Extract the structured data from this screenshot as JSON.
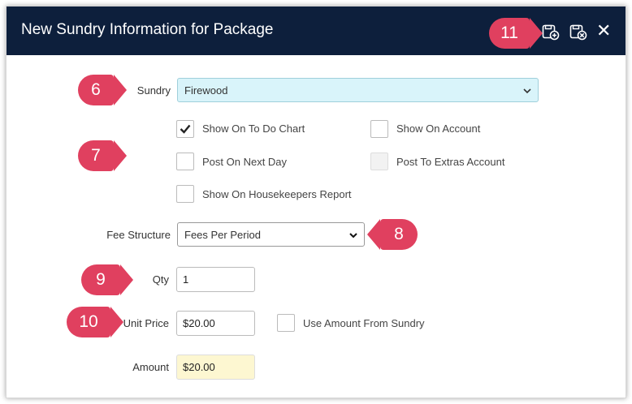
{
  "dialog": {
    "title": "New Sundry Information for Package"
  },
  "header_icons": {
    "save_add": "save-add-icon",
    "save_close": "save-close-icon",
    "close": "close-icon",
    "close_glyph": "✕"
  },
  "callouts": {
    "c6": "6",
    "c7": "7",
    "c8": "8",
    "c9": "9",
    "c10": "10",
    "c11": "11"
  },
  "form": {
    "sundry_label": "Sundry",
    "sundry_value": "Firewood",
    "checkboxes": [
      {
        "label": "Show On To Do Chart",
        "checked": true
      },
      {
        "label": "Show On Account",
        "checked": false
      },
      {
        "label": "Post On Next Day",
        "checked": false
      },
      {
        "label": "Post To Extras Account",
        "checked": false,
        "disabled": true
      },
      {
        "label": "Show On Housekeepers Report",
        "checked": false
      }
    ],
    "fee_structure_label": "Fee Structure",
    "fee_structure_value": "Fees Per Period",
    "qty_label": "Qty",
    "qty_value": "1",
    "unit_price_label": "Unit Price",
    "unit_price_value": "$20.00",
    "use_amount_label": "Use Amount From Sundry",
    "amount_label": "Amount",
    "amount_value": "$20.00"
  },
  "colors": {
    "header_bg": "#0d1f3c",
    "callout": "#e0405f",
    "sundry_bg": "#d9f4fa",
    "amount_bg": "#fdf7d1"
  }
}
